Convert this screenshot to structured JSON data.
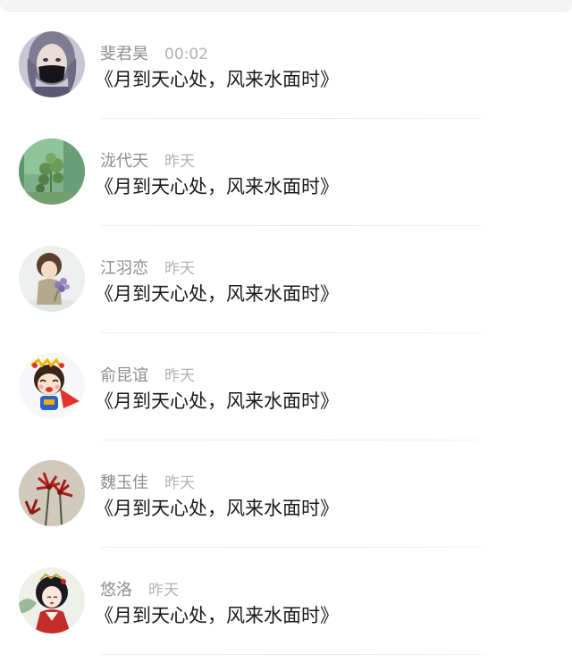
{
  "chats": [
    {
      "name": "斐君昊",
      "time": "00:02",
      "message": "《月到天心处，风来水面时》",
      "avatar": "masked-person-avatar"
    },
    {
      "name": "泷代天",
      "time": "昨天",
      "message": "《月到天心处，风来水面时》",
      "avatar": "plant-avatar"
    },
    {
      "name": "江羽恋",
      "time": "昨天",
      "message": "《月到天心处，风来水面时》",
      "avatar": "girl-with-flowers-avatar"
    },
    {
      "name": "俞昆谊",
      "time": "昨天",
      "message": "《月到天心处，风来水面时》",
      "avatar": "cartoon-superhero-avatar"
    },
    {
      "name": "魏玉佳",
      "time": "昨天",
      "message": "《月到天心处，风来水面时》",
      "avatar": "red-lily-avatar"
    },
    {
      "name": "悠洛",
      "time": "昨天",
      "message": "《月到天心处，风来水面时》",
      "avatar": "ancient-costume-girl-avatar"
    }
  ]
}
